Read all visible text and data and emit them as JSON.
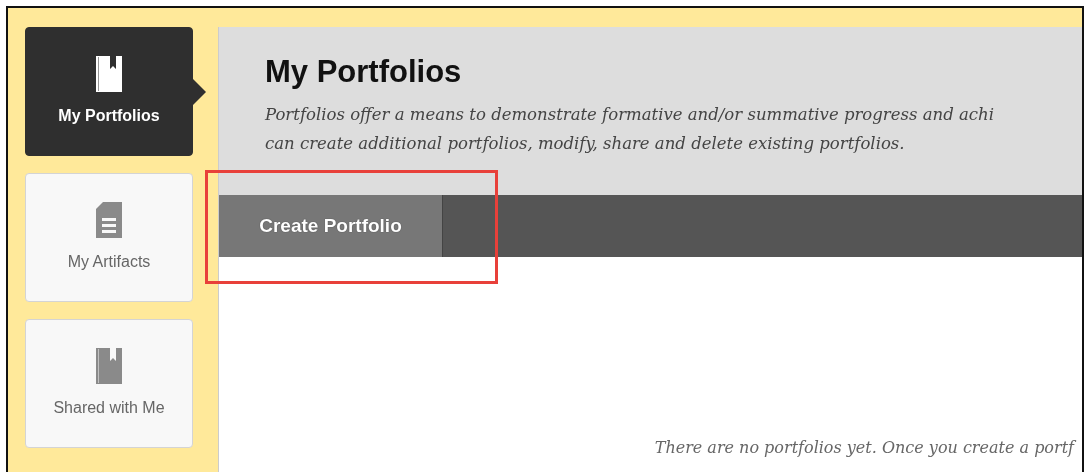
{
  "sidebar": {
    "items": [
      {
        "label": "My Portfolios",
        "kind": "book",
        "selected": true
      },
      {
        "label": "My Artifacts",
        "kind": "document",
        "selected": false
      },
      {
        "label": "Shared with Me",
        "kind": "book",
        "selected": false
      }
    ]
  },
  "header": {
    "title": "My Portfolios",
    "description_lines": [
      "Portfolios offer a means to demonstrate formative and/or summative progress and achi",
      "can create additional portfolios, modify, share and delete existing portfolios."
    ]
  },
  "action_bar": {
    "buttons": [
      "Create Portfolio"
    ]
  },
  "highlight": {
    "shown": true
  },
  "empty_message": "There are no portfolios yet. Once you create a portf"
}
